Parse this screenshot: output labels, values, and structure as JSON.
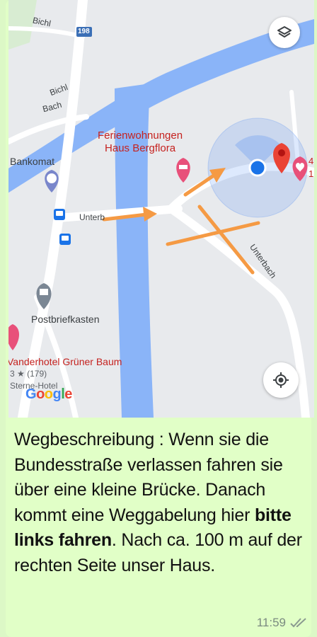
{
  "map": {
    "road_labels": {
      "bichl_top": "Bichl",
      "road_number": "198",
      "bichl_mid": "Bichl",
      "bach": "Bach",
      "unterbach_left": "Unterb",
      "unterbach_right": "Unterbach"
    },
    "places": {
      "ferienwohnungen_line1": "Ferienwohnungen",
      "ferienwohnungen_line2": "Haus Bergflora",
      "bankomat": "Bankomat",
      "postbriefkasten": "Postbriefkasten",
      "hotel_name": "Vanderhotel Grüner Baum",
      "hotel_rating": "3 ★ (179)",
      "hotel_type": "Sterne-Hotel",
      "edge_digit_top": "4",
      "edge_digit_bottom": "1"
    },
    "google_logo": [
      "G",
      "o",
      "o",
      "g",
      "l",
      "e"
    ],
    "google_colors": [
      "#4285f4",
      "#ea4335",
      "#fbbc05",
      "#4285f4",
      "#34a853",
      "#ea4335"
    ]
  },
  "message": {
    "text_1": "Wegbeschreibung : Wenn sie die Bundesstraße verlassen fahren sie über eine kleine Brücke. Danach kommt eine Weggabelung hier ",
    "text_bold": "bitte links fahren",
    "text_2": ". Nach ca. 100 m auf der rechten Seite unser Haus.",
    "time": "11:59"
  },
  "colors": {
    "river": "#8ab4f8",
    "arrow": "#f59a44",
    "bubble": "#e1ffc7",
    "accent_red": "#c5221f"
  }
}
